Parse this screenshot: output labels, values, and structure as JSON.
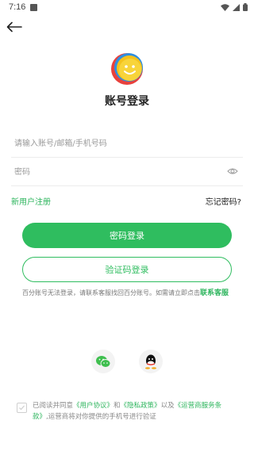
{
  "status_bar": {
    "time": "7:16"
  },
  "header": {
    "title": "账号登录"
  },
  "form": {
    "account_placeholder": "请输入账号/邮箱/手机号码",
    "password_placeholder": "密码"
  },
  "links": {
    "register": "新用户注册",
    "forgot": "忘记密码?"
  },
  "buttons": {
    "password_login": "密码登录",
    "code_login": "验证码登录"
  },
  "notice": {
    "text": "百分账号无法登录，请联系客服找回百分账号。如需请立即点击",
    "link": "联系客服"
  },
  "social": [
    "wechat",
    "qq"
  ],
  "agreement": {
    "prefix": "已阅读并同意",
    "user_agreement": "《用户协议》",
    "and": "和",
    "privacy": "《隐私政策》",
    "and2": "以及",
    "operator_terms": "《运营商服务条款》",
    "suffix": ",运营商将对你提供的手机号进行验证"
  },
  "colors": {
    "accent": "#2fbd5f"
  }
}
